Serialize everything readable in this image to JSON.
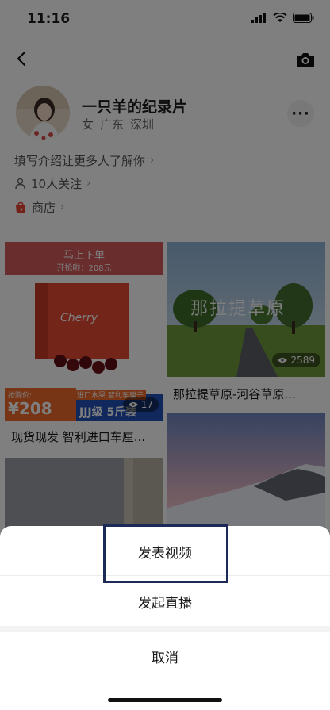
{
  "status": {
    "time": "11:16"
  },
  "profile": {
    "name": "一只羊的纪录片",
    "gender": "女",
    "province": "广东",
    "city": "深圳",
    "intro": "填写介绍让更多人了解你",
    "followers": "10人关注",
    "shop": "商店"
  },
  "cards": [
    {
      "title": "现货现发 智利进口车厘...",
      "views": "17",
      "promo_top": "马上下单",
      "promo_price_start": "开抢啦：208元",
      "promo_buy_label": "抢购价:",
      "promo_price": "¥208",
      "promo_badge": "进口水果 智利车厘子",
      "promo_grade": "JJJ级 5斤装",
      "brand": "Cherry"
    },
    {
      "title": "那拉提草原-河谷草原...",
      "views": "2589",
      "overlay_text": "那拉提草原"
    },
    {
      "title": "",
      "views": ""
    },
    {
      "title": "",
      "views": ""
    }
  ],
  "sheet": {
    "publish_video": "发表视频",
    "start_live": "发起直播",
    "cancel": "取消"
  },
  "colors": {
    "highlight": "#1b2a57",
    "promo_orange": "#f06b2d",
    "promo_blue": "#2050b8"
  }
}
